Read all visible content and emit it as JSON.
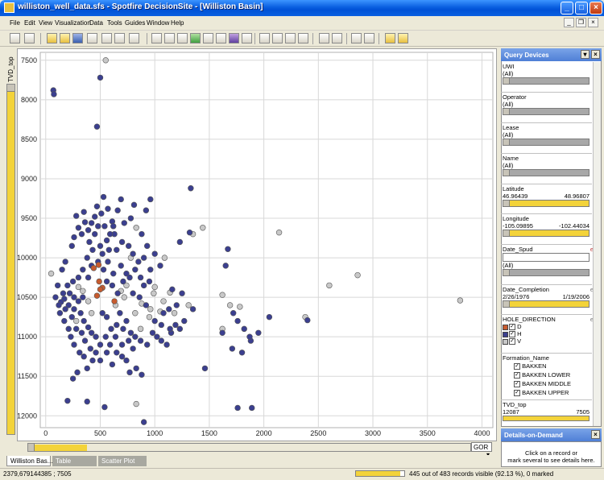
{
  "window": {
    "title": "williston_well_data.sfs - Spotfire DecisionSite - [Williston Basin]",
    "minimize": "_",
    "maximize": "□",
    "close": "×",
    "mdi_minimize": "_",
    "mdi_restore": "❐",
    "mdi_close": "×"
  },
  "menu": [
    "File",
    "Edit",
    "View",
    "Visualization",
    "Data",
    "Tools",
    "Guides",
    "Window",
    "Help"
  ],
  "chart_data": {
    "type": "scatter",
    "ylabel": "TVD_top",
    "xlabel": "GOR",
    "xlim": [
      -50,
      4100
    ],
    "ylim": [
      12150,
      7400
    ],
    "y_inverted": true,
    "grid": true,
    "x_ticks": [
      "0",
      "500",
      "1000",
      "1500",
      "2000",
      "2500",
      "3000",
      "3500",
      "4000"
    ],
    "y_ticks": [
      "7500",
      "8000",
      "8500",
      "9000",
      "9500",
      "10000",
      "10500",
      "11000",
      "11500",
      "12000"
    ],
    "series": [
      {
        "name": "D",
        "color": "#c75b2e",
        "points": [
          [
            485,
            10090
          ],
          [
            440,
            10130
          ],
          [
            630,
            10550
          ],
          [
            520,
            10380
          ],
          [
            490,
            10300
          ],
          [
            470,
            10480
          ],
          [
            500,
            10400
          ]
        ]
      },
      {
        "name": "V",
        "color": "#c8c8c8",
        "points": [
          [
            550,
            7500
          ],
          [
            50,
            10200
          ],
          [
            780,
            10000
          ],
          [
            830,
            9620
          ],
          [
            1090,
            10000
          ],
          [
            1440,
            9620
          ],
          [
            1350,
            9700
          ],
          [
            2140,
            9680
          ],
          [
            2600,
            10350
          ],
          [
            2860,
            10220
          ],
          [
            3800,
            10540
          ],
          [
            2380,
            10750
          ],
          [
            1690,
            10600
          ],
          [
            1620,
            10470
          ],
          [
            1780,
            10620
          ],
          [
            1140,
            10440
          ],
          [
            1000,
            10370
          ],
          [
            990,
            10450
          ],
          [
            880,
            10580
          ],
          [
            960,
            10650
          ],
          [
            1080,
            10550
          ],
          [
            1180,
            10700
          ],
          [
            1310,
            10600
          ],
          [
            300,
            10370
          ],
          [
            340,
            10420
          ],
          [
            390,
            10550
          ],
          [
            420,
            10700
          ],
          [
            280,
            10800
          ],
          [
            740,
            10350
          ],
          [
            690,
            10420
          ],
          [
            640,
            10600
          ],
          [
            820,
            10700
          ],
          [
            870,
            10900
          ],
          [
            830,
            11850
          ],
          [
            950,
            10750
          ],
          [
            1050,
            10680
          ],
          [
            720,
            10500
          ],
          [
            1620,
            10900
          ]
        ]
      },
      {
        "name": "H",
        "color": "#3b3f8f",
        "points": [
          [
            70,
            7880
          ],
          [
            75,
            7930
          ],
          [
            500,
            7720
          ],
          [
            470,
            8340
          ],
          [
            1330,
            9120
          ],
          [
            960,
            9260
          ],
          [
            530,
            9230
          ],
          [
            690,
            9260
          ],
          [
            570,
            9380
          ],
          [
            810,
            9330
          ],
          [
            780,
            9500
          ],
          [
            920,
            9400
          ],
          [
            280,
            9470
          ],
          [
            350,
            9420
          ],
          [
            420,
            9560
          ],
          [
            390,
            9650
          ],
          [
            330,
            9700
          ],
          [
            260,
            9740
          ],
          [
            400,
            9800
          ],
          [
            500,
            9850
          ],
          [
            560,
            9780
          ],
          [
            630,
            9700
          ],
          [
            610,
            9540
          ],
          [
            480,
            9600
          ],
          [
            450,
            9700
          ],
          [
            580,
            9900
          ],
          [
            520,
            9950
          ],
          [
            480,
            10050
          ],
          [
            420,
            10100
          ],
          [
            380,
            10000
          ],
          [
            340,
            10150
          ],
          [
            300,
            10250
          ],
          [
            250,
            10300
          ],
          [
            200,
            10350
          ],
          [
            160,
            10450
          ],
          [
            170,
            10520
          ],
          [
            140,
            10560
          ],
          [
            210,
            10600
          ],
          [
            260,
            10650
          ],
          [
            320,
            10700
          ],
          [
            350,
            10800
          ],
          [
            390,
            10880
          ],
          [
            420,
            10950
          ],
          [
            460,
            11000
          ],
          [
            500,
            11100
          ],
          [
            560,
            11200
          ],
          [
            430,
            11300
          ],
          [
            380,
            11400
          ],
          [
            290,
            11450
          ],
          [
            250,
            11530
          ],
          [
            200,
            11810
          ],
          [
            380,
            11820
          ],
          [
            540,
            11890
          ],
          [
            900,
            12080
          ],
          [
            880,
            11480
          ],
          [
            830,
            11400
          ],
          [
            770,
            11450
          ],
          [
            700,
            11100
          ],
          [
            640,
            11000
          ],
          [
            600,
            10900
          ],
          [
            560,
            10750
          ],
          [
            520,
            10700
          ],
          [
            680,
            10700
          ],
          [
            740,
            10800
          ],
          [
            780,
            10950
          ],
          [
            820,
            11000
          ],
          [
            870,
            11050
          ],
          [
            930,
            11100
          ],
          [
            980,
            10950
          ],
          [
            1020,
            11000
          ],
          [
            1060,
            11050
          ],
          [
            1110,
            11100
          ],
          [
            1150,
            10950
          ],
          [
            1190,
            10850
          ],
          [
            1230,
            10900
          ],
          [
            1270,
            10800
          ],
          [
            1130,
            10650
          ],
          [
            1200,
            10600
          ],
          [
            1350,
            10650
          ],
          [
            1250,
            10450
          ],
          [
            1160,
            10400
          ],
          [
            1230,
            9800
          ],
          [
            1320,
            9680
          ],
          [
            1670,
            9890
          ],
          [
            1650,
            10100
          ],
          [
            1720,
            10700
          ],
          [
            1760,
            10800
          ],
          [
            1820,
            10900
          ],
          [
            1710,
            11150
          ],
          [
            1800,
            11200
          ],
          [
            1880,
            11050
          ],
          [
            1950,
            10950
          ],
          [
            1890,
            11900
          ],
          [
            1760,
            11900
          ],
          [
            1620,
            10950
          ],
          [
            1460,
            11400
          ],
          [
            2050,
            10750
          ],
          [
            2400,
            10790
          ],
          [
            1870,
            11000
          ],
          [
            1060,
            10850
          ],
          [
            1140,
            10900
          ],
          [
            1000,
            10800
          ],
          [
            1080,
            10700
          ],
          [
            920,
            10600
          ],
          [
            860,
            10500
          ],
          [
            800,
            10450
          ],
          [
            740,
            10200
          ],
          [
            690,
            10100
          ],
          [
            620,
            10200
          ],
          [
            570,
            10050
          ],
          [
            530,
            10150
          ],
          [
            560,
            10300
          ],
          [
            610,
            10350
          ],
          [
            660,
            10450
          ],
          [
            710,
            10300
          ],
          [
            770,
            10250
          ],
          [
            820,
            10150
          ],
          [
            870,
            10250
          ],
          [
            900,
            10350
          ],
          [
            950,
            10300
          ],
          [
            850,
            10050
          ],
          [
            800,
            9950
          ],
          [
            760,
            9850
          ],
          [
            700,
            9800
          ],
          [
            650,
            9900
          ],
          [
            590,
            9700
          ],
          [
            620,
            9600
          ],
          [
            540,
            9600
          ],
          [
            430,
            9900
          ],
          [
            390,
            10250
          ],
          [
            340,
            10500
          ],
          [
            300,
            10550
          ],
          [
            260,
            10500
          ],
          [
            220,
            10450
          ],
          [
            180,
            10650
          ],
          [
            130,
            10700
          ],
          [
            240,
            10750
          ],
          [
            280,
            10900
          ],
          [
            330,
            10950
          ],
          [
            360,
            11050
          ],
          [
            410,
            11150
          ],
          [
            460,
            11200
          ],
          [
            500,
            11300
          ],
          [
            550,
            11000
          ],
          [
            590,
            11100
          ],
          [
            650,
            10850
          ],
          [
            710,
            10900
          ],
          [
            760,
            11050
          ],
          [
            800,
            11150
          ],
          [
            700,
            11250
          ],
          [
            650,
            11200
          ],
          [
            610,
            11350
          ],
          [
            740,
            11300
          ],
          [
            660,
            9400
          ],
          [
            720,
            9560
          ],
          [
            880,
            9700
          ],
          [
            930,
            9850
          ],
          [
            1000,
            9950
          ],
          [
            1050,
            10100
          ],
          [
            960,
            10150
          ],
          [
            900,
            10000
          ],
          [
            470,
            9350
          ],
          [
            510,
            9440
          ],
          [
            450,
            9480
          ],
          [
            360,
            9550
          ],
          [
            300,
            9620
          ],
          [
            240,
            9850
          ],
          [
            180,
            10050
          ],
          [
            150,
            10150
          ],
          [
            110,
            10350
          ],
          [
            90,
            10500
          ],
          [
            120,
            10600
          ],
          [
            170,
            10800
          ],
          [
            210,
            10900
          ],
          [
            230,
            11000
          ],
          [
            260,
            11100
          ],
          [
            310,
            11200
          ],
          [
            350,
            11250
          ]
        ]
      }
    ]
  },
  "axis": {
    "y_field": "TVD_top",
    "x_field": "GOR"
  },
  "tabs": [
    "Williston Bas...",
    "Table",
    "Scatter Plot"
  ],
  "status": {
    "coords": "2379,679144385 ; 7505",
    "visible_fraction": 0.9213,
    "records_text": "445 out of 483 records visible (92.13 %), 0 marked"
  },
  "query_devices": {
    "title": "Query Devices",
    "uwi": {
      "name": "UWI",
      "value": "(All)"
    },
    "operator": {
      "name": "Operator",
      "value": "(All)"
    },
    "lease": {
      "name": "Lease",
      "value": "(All)"
    },
    "well_name": {
      "name": "Name",
      "value": "(All)"
    },
    "latitude": {
      "name": "Latitude",
      "min": "46.96439",
      "max": "48.96807"
    },
    "longitude": {
      "name": "Longitude",
      "min": "-105.09895",
      "max": "-102.44034"
    },
    "date_spud": {
      "name": "Date_Spud",
      "value": "(All)",
      "flag": "e"
    },
    "date_completion": {
      "name": "Date_Completion",
      "min": "2/26/1976",
      "max": "1/19/2006",
      "flag": "e"
    },
    "hole_direction": {
      "name": "HOLE_DIRECTION",
      "flag": "e",
      "items": [
        {
          "label": "D",
          "color": "#c75b2e"
        },
        {
          "label": "H",
          "color": "#3b3f8f"
        },
        {
          "label": "V",
          "color": "#c8c8c8"
        }
      ]
    },
    "formation": {
      "name": "Formation_Name",
      "items": [
        "BAKKEN",
        "BAKKEN LOWER",
        "BAKKEN MIDDLE",
        "BAKKEN UPPER"
      ]
    },
    "tvd_top": {
      "name": "TVD_top",
      "min": "12087",
      "max": "7505"
    }
  },
  "details": {
    "title": "Details-on-Demand",
    "line1": "Click on a record or",
    "line2": "mark several to see details here."
  }
}
